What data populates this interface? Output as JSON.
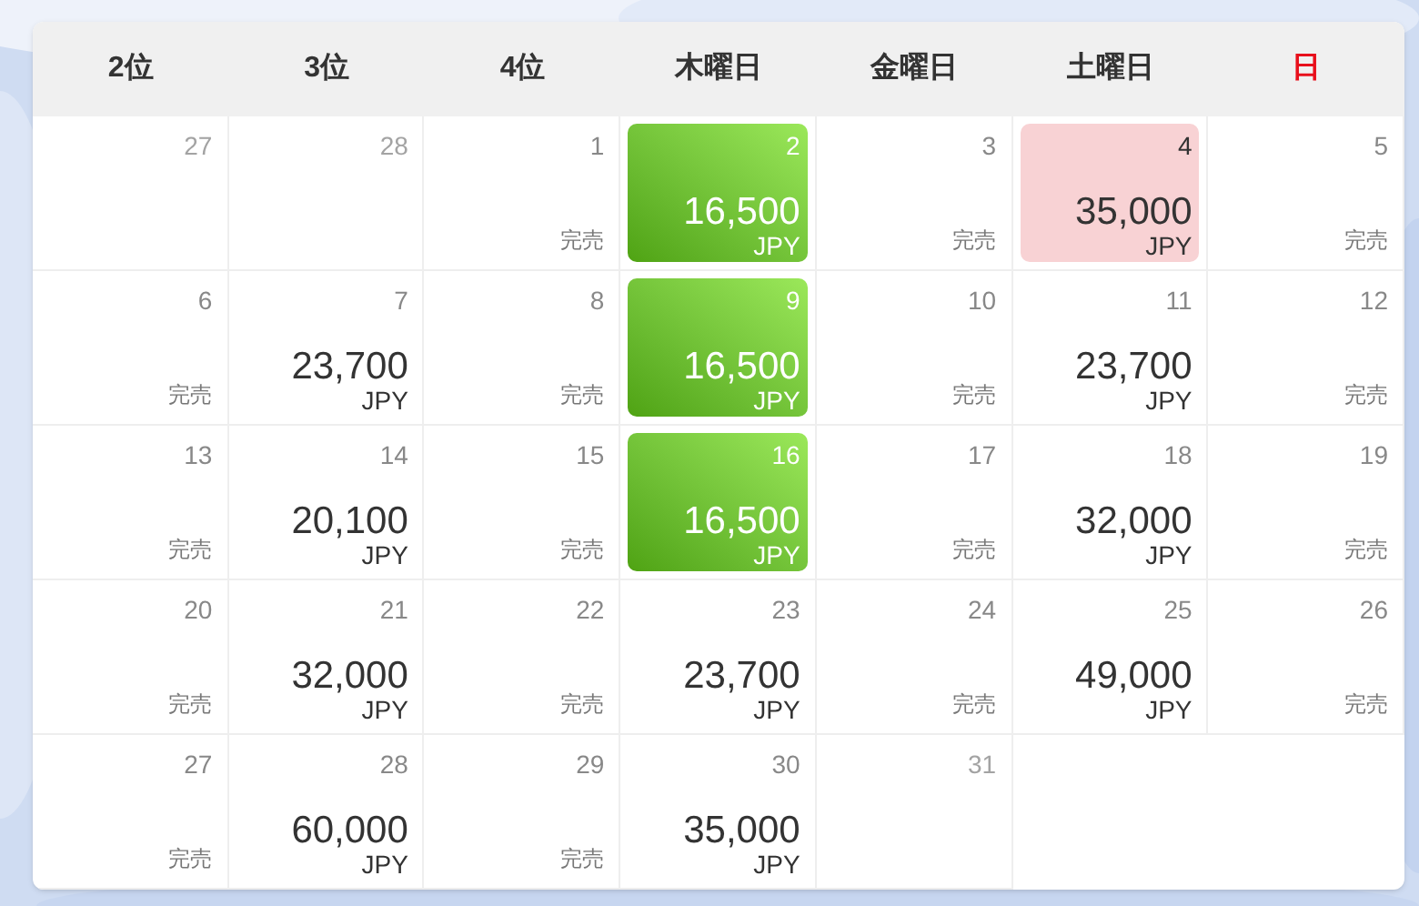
{
  "header": [
    {
      "label": "2位",
      "weekend": false
    },
    {
      "label": "3位",
      "weekend": false
    },
    {
      "label": "4位",
      "weekend": false
    },
    {
      "label": "木曜日",
      "weekend": false
    },
    {
      "label": "金曜日",
      "weekend": false
    },
    {
      "label": "土曜日",
      "weekend": false
    },
    {
      "label": "日",
      "weekend": true
    }
  ],
  "weeks": [
    [
      {
        "kind": "outside",
        "day": "27"
      },
      {
        "kind": "outside",
        "day": "28"
      },
      {
        "kind": "soldout",
        "day": "1",
        "note": "完売"
      },
      {
        "kind": "price",
        "day": "2",
        "price": "16,500",
        "currency": "JPY",
        "selected": true,
        "flagged": false
      },
      {
        "kind": "soldout",
        "day": "3",
        "note": "完売"
      },
      {
        "kind": "price",
        "day": "4",
        "price": "35,000",
        "currency": "JPY",
        "selected": false,
        "flagged": true
      },
      {
        "kind": "soldout",
        "day": "5",
        "note": "完売"
      }
    ],
    [
      {
        "kind": "soldout",
        "day": "6",
        "note": "完売"
      },
      {
        "kind": "price",
        "day": "7",
        "price": "23,700",
        "currency": "JPY",
        "selected": false,
        "flagged": false
      },
      {
        "kind": "soldout",
        "day": "8",
        "note": "完売"
      },
      {
        "kind": "price",
        "day": "9",
        "price": "16,500",
        "currency": "JPY",
        "selected": true,
        "flagged": false
      },
      {
        "kind": "soldout",
        "day": "10",
        "note": "完売"
      },
      {
        "kind": "price",
        "day": "11",
        "price": "23,700",
        "currency": "JPY",
        "selected": false,
        "flagged": false
      },
      {
        "kind": "soldout",
        "day": "12",
        "note": "完売"
      }
    ],
    [
      {
        "kind": "soldout",
        "day": "13",
        "note": "完売"
      },
      {
        "kind": "price",
        "day": "14",
        "price": "20,100",
        "currency": "JPY",
        "selected": false,
        "flagged": false
      },
      {
        "kind": "soldout",
        "day": "15",
        "note": "完売"
      },
      {
        "kind": "price",
        "day": "16",
        "price": "16,500",
        "currency": "JPY",
        "selected": true,
        "flagged": false
      },
      {
        "kind": "soldout",
        "day": "17",
        "note": "完売"
      },
      {
        "kind": "price",
        "day": "18",
        "price": "32,000",
        "currency": "JPY",
        "selected": false,
        "flagged": false
      },
      {
        "kind": "soldout",
        "day": "19",
        "note": "完売"
      }
    ],
    [
      {
        "kind": "soldout",
        "day": "20",
        "note": "完売"
      },
      {
        "kind": "price",
        "day": "21",
        "price": "32,000",
        "currency": "JPY",
        "selected": false,
        "flagged": false
      },
      {
        "kind": "soldout",
        "day": "22",
        "note": "完売"
      },
      {
        "kind": "price",
        "day": "23",
        "price": "23,700",
        "currency": "JPY",
        "selected": false,
        "flagged": false
      },
      {
        "kind": "soldout",
        "day": "24",
        "note": "完売"
      },
      {
        "kind": "price",
        "day": "25",
        "price": "49,000",
        "currency": "JPY",
        "selected": false,
        "flagged": false
      },
      {
        "kind": "soldout",
        "day": "26",
        "note": "完売"
      }
    ],
    [
      {
        "kind": "soldout",
        "day": "27",
        "note": "完売"
      },
      {
        "kind": "price",
        "day": "28",
        "price": "60,000",
        "currency": "JPY",
        "selected": false,
        "flagged": false
      },
      {
        "kind": "soldout",
        "day": "29",
        "note": "完売"
      },
      {
        "kind": "price",
        "day": "30",
        "price": "35,000",
        "currency": "JPY",
        "selected": false,
        "flagged": false
      },
      {
        "kind": "outside",
        "day": "31"
      },
      {
        "kind": "blank"
      },
      {
        "kind": "blank"
      }
    ]
  ]
}
